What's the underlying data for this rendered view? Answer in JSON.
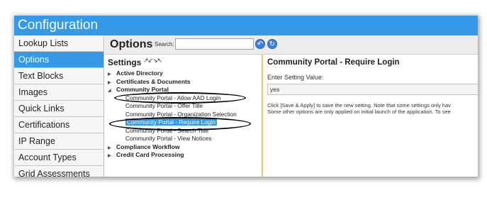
{
  "window": {
    "title": "Configuration"
  },
  "sidebar": {
    "items": [
      {
        "label": "Lookup Lists",
        "active": false
      },
      {
        "label": "Options",
        "active": true
      },
      {
        "label": "Text Blocks",
        "active": false
      },
      {
        "label": "Images",
        "active": false
      },
      {
        "label": "Quick Links",
        "active": false
      },
      {
        "label": "Certifications",
        "active": false
      },
      {
        "label": "IP Range",
        "active": false
      },
      {
        "label": "Account Types",
        "active": false
      },
      {
        "label": "Grid Assessments",
        "active": false
      }
    ]
  },
  "options_bar": {
    "title": "Options",
    "search_label": "Search:",
    "search_value": "",
    "icons": [
      "back-icon",
      "refresh-icon"
    ]
  },
  "settings": {
    "heading": "Settings",
    "tree": [
      {
        "label": "Active Directory",
        "level": 0,
        "expanded": false
      },
      {
        "label": "Certificates & Documents",
        "level": 0,
        "expanded": false
      },
      {
        "label": "Community Portal",
        "level": 0,
        "expanded": true
      },
      {
        "label": "Community Portal - Allow AAD Login",
        "level": 1
      },
      {
        "label": "Community Portal - Offer Title",
        "level": 1
      },
      {
        "label": "Community Portal - Organization Selection",
        "level": 1
      },
      {
        "label": "Community Portal - Require Login",
        "level": 1,
        "selected": true
      },
      {
        "label": "Community Portal - Search Title",
        "level": 1
      },
      {
        "label": "Community Portal - View Notices",
        "level": 1
      },
      {
        "label": "Compliance Workflow",
        "level": 0,
        "expanded": false
      },
      {
        "label": "Credit Card Processing",
        "level": 0,
        "expanded": false
      }
    ]
  },
  "detail": {
    "title": "Community Portal - Require Login",
    "label": "Enter Setting Value:",
    "value": "yes",
    "note_line1": "Click [Save & Apply] to save the new setting. Note that some settings only hav",
    "note_line2": "Some other options are only applied on initial launch of the application. To see"
  },
  "colors": {
    "accent": "#3399e8",
    "divider": "#f0c26a"
  }
}
